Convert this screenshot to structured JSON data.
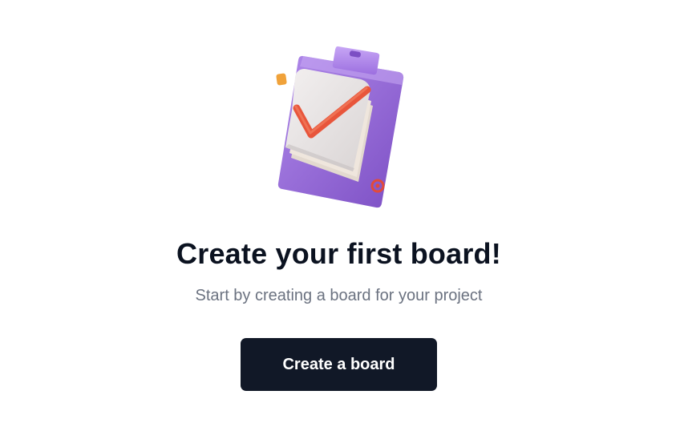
{
  "empty_state": {
    "title": "Create your first board!",
    "subtitle": "Start by creating a board for your project",
    "cta_label": "Create a board"
  },
  "icons": {
    "illustration": "clipboard-checkmark-icon"
  },
  "colors": {
    "title": "#0b1220",
    "subtitle": "#6b7280",
    "button_background": "#111827",
    "button_text": "#ffffff",
    "clipboard_purple": "#9b6fd6",
    "checkmark_orange": "#e8553b"
  }
}
